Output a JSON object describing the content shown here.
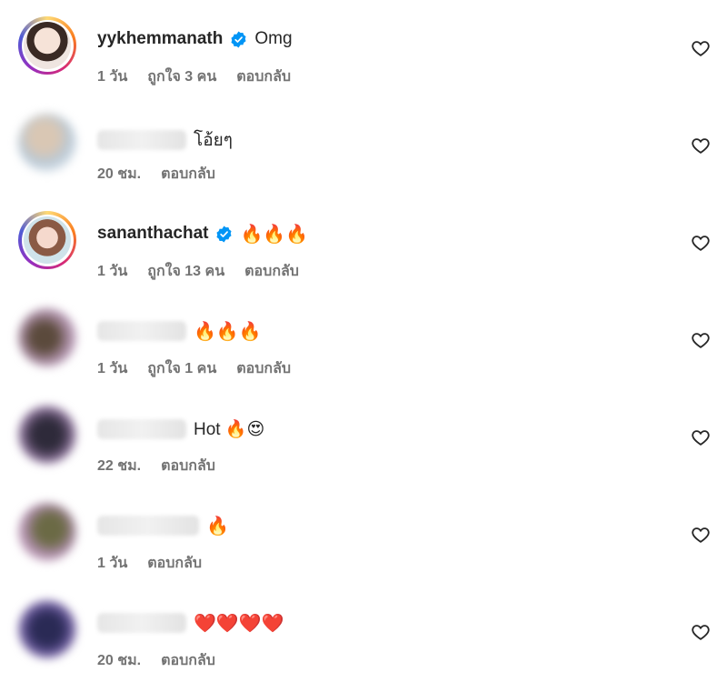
{
  "comments": [
    {
      "username": "yykhemmanath",
      "verified": true,
      "text": "Omg",
      "time": "1 วัน",
      "likes": "ถูกใจ 3 คน",
      "reply": "ตอบกลับ",
      "avatar_colors": [
        "#f3e8e4",
        "#c9a58f"
      ]
    },
    {
      "username": "",
      "verified": false,
      "text": "โอ้ยๆ",
      "time": "20 ชม.",
      "likes": "",
      "reply": "ตอบกลับ",
      "avatar_colors": [
        "#b8c8d6",
        "#d9c7b4"
      ]
    },
    {
      "username": "sananthachat",
      "verified": true,
      "text": "🔥🔥🔥",
      "time": "1 วัน",
      "likes": "ถูกใจ 13 คน",
      "reply": "ตอบกลับ",
      "avatar_colors": [
        "#f5d9cd",
        "#b97b5e"
      ]
    },
    {
      "username": "",
      "verified": false,
      "text": "🔥🔥🔥",
      "time": "1 วัน",
      "likes": "ถูกใจ 1 คน",
      "reply": "ตอบกลับ",
      "avatar_colors": [
        "#d3b5d8",
        "#5b4a3c"
      ]
    },
    {
      "username": "",
      "verified": false,
      "text": "Hot 🔥😍",
      "time": "22 ชม.",
      "likes": "",
      "reply": "ตอบกลับ",
      "avatar_colors": [
        "#c7a8d6",
        "#2e2a3a"
      ]
    },
    {
      "username": "",
      "verified": false,
      "text": "🔥",
      "time": "1 วัน",
      "likes": "",
      "reply": "ตอบกลับ",
      "avatar_colors": [
        "#e0bfd8",
        "#6b6a45"
      ]
    },
    {
      "username": "",
      "verified": false,
      "text": "❤️❤️❤️❤️",
      "time": "20 ชม.",
      "likes": "",
      "reply": "ตอบกลับ",
      "avatar_colors": [
        "#b9a3d8",
        "#2a2a55"
      ]
    }
  ],
  "icons": {
    "verified": "verified-badge-icon",
    "like": "heart-outline-icon"
  },
  "colors": {
    "text": "#262626",
    "meta": "#737373",
    "verified": "#0095f6"
  }
}
